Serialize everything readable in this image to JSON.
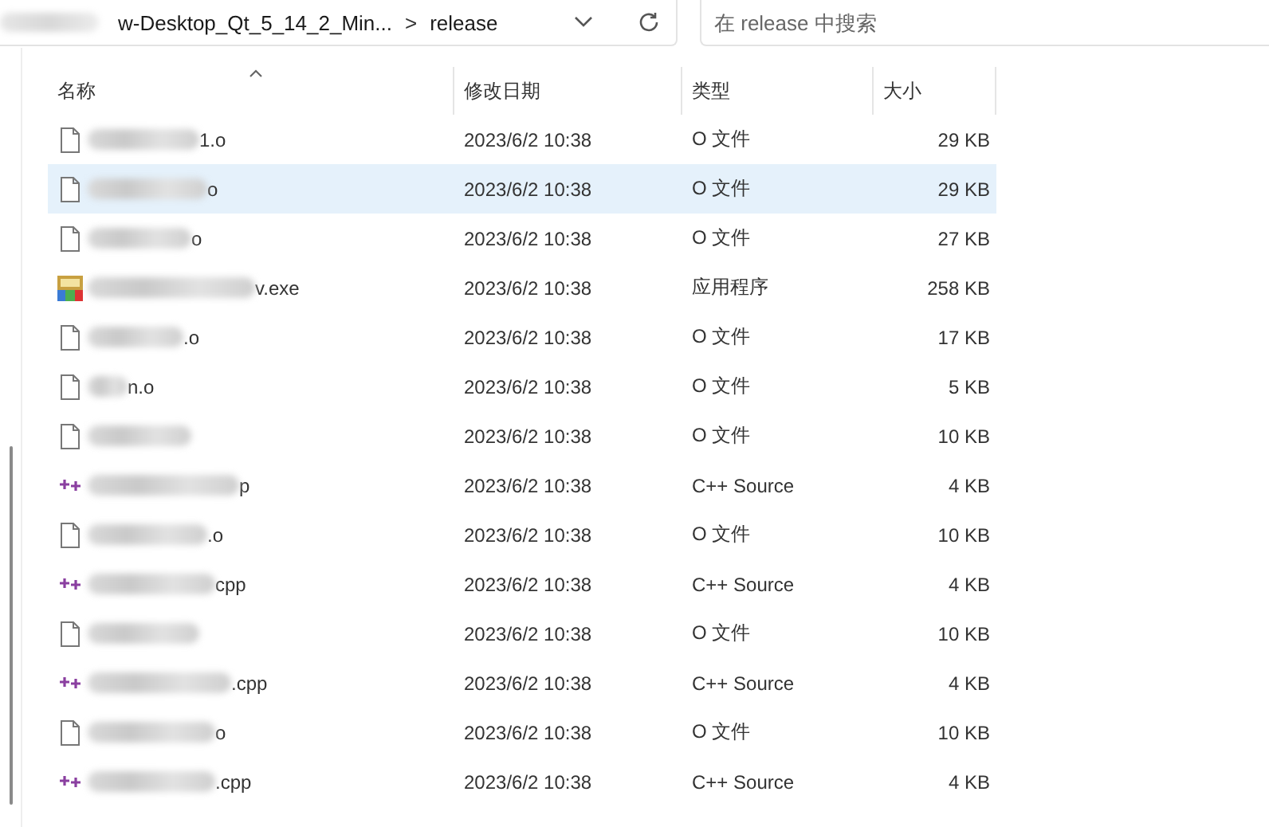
{
  "address_bar": {
    "path_segments": [
      "w-Desktop_Qt_5_14_2_Min...",
      "release"
    ],
    "separator": ">"
  },
  "search": {
    "placeholder": "在 release 中搜索"
  },
  "columns": [
    "名称",
    "修改日期",
    "类型",
    "大小"
  ],
  "files": [
    {
      "kind": "file",
      "name": "1.o",
      "modified": "2023/6/2 10:38",
      "type": "O 文件",
      "size": "29 KB",
      "selected": false
    },
    {
      "kind": "file",
      "name": "o",
      "modified": "2023/6/2 10:38",
      "type": "O 文件",
      "size": "29 KB",
      "selected": true
    },
    {
      "kind": "file",
      "name": "o",
      "modified": "2023/6/2 10:38",
      "type": "O 文件",
      "size": "27 KB",
      "selected": false
    },
    {
      "kind": "exe",
      "name": "v.exe",
      "modified": "2023/6/2 10:38",
      "type": "应用程序",
      "size": "258 KB",
      "selected": false
    },
    {
      "kind": "file",
      "name": ".o",
      "modified": "2023/6/2 10:38",
      "type": "O 文件",
      "size": "17 KB",
      "selected": false
    },
    {
      "kind": "file",
      "name": "n.o",
      "modified": "2023/6/2 10:38",
      "type": "O 文件",
      "size": "5 KB",
      "selected": false
    },
    {
      "kind": "file",
      "modified": "2023/6/2 10:38",
      "type": "O 文件",
      "size": "10 KB",
      "selected": false
    },
    {
      "kind": "cpp",
      "name": "p",
      "modified": "2023/6/2 10:38",
      "type": "C++ Source",
      "size": "4 KB",
      "selected": false
    },
    {
      "kind": "file",
      "name": ".o",
      "modified": "2023/6/2 10:38",
      "type": "O 文件",
      "size": "10 KB",
      "selected": false
    },
    {
      "kind": "cpp",
      "name": "cpp",
      "modified": "2023/6/2 10:38",
      "type": "C++ Source",
      "size": "4 KB",
      "selected": false
    },
    {
      "kind": "file",
      "modified": "2023/6/2 10:38",
      "type": "O 文件",
      "size": "10 KB",
      "selected": false
    },
    {
      "kind": "cpp",
      "name": ".cpp",
      "modified": "2023/6/2 10:38",
      "type": "C++ Source",
      "size": "4 KB",
      "selected": false
    },
    {
      "kind": "file",
      "name": "o",
      "modified": "2023/6/2 10:38",
      "type": "O 文件",
      "size": "10 KB",
      "selected": false
    },
    {
      "kind": "cpp",
      "name": ".cpp",
      "modified": "2023/6/2 10:38",
      "type": "C++ Source",
      "size": "4 KB",
      "selected": false
    }
  ]
}
